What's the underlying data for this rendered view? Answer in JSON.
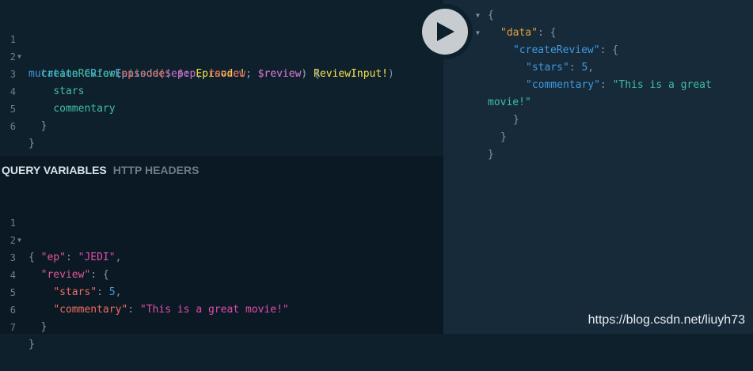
{
  "query": {
    "line_numbers": [
      "1",
      "2",
      "3",
      "4",
      "5",
      "6"
    ],
    "mutation_keyword": "mutation",
    "operation_name": "CRforEpisode",
    "var_ep": "$ep",
    "type_episode": "Episode!",
    "var_review": "$review",
    "type_review_input": "ReviewInput!",
    "field_create_review": "createReview",
    "arg_episode": "episode",
    "arg_review": "review",
    "field_stars": "stars",
    "field_commentary": "commentary"
  },
  "tabs": {
    "query_variables": "QUERY VARIABLES",
    "http_headers": "HTTP HEADERS"
  },
  "variables": {
    "line_numbers": [
      "1",
      "2",
      "3",
      "4",
      "5",
      "6",
      "7"
    ],
    "key_ep": "\"ep\"",
    "value_ep": "\"JEDI\"",
    "key_review": "\"review\"",
    "key_stars": "\"stars\"",
    "value_stars": "5",
    "key_commentary": "\"commentary\"",
    "value_commentary": "\"This is a great movie!\""
  },
  "result": {
    "key_data": "\"data\"",
    "key_create_review": "\"createReview\"",
    "key_stars": "\"stars\"",
    "value_stars": "5",
    "key_commentary": "\"commentary\"",
    "value_commentary_part1": "\"This is a great",
    "value_commentary_part2": "movie!\""
  },
  "watermark": "https://blog.csdn.net/liuyh73",
  "icons": {
    "run": "play-icon",
    "fold": "fold-arrow-icon"
  }
}
